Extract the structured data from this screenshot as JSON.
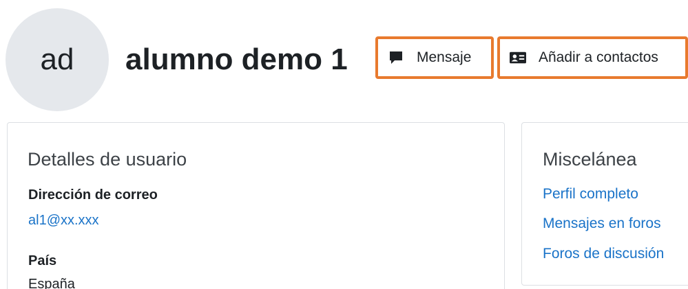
{
  "header": {
    "avatar_initials": "ad",
    "user_name": "alumno demo 1",
    "actions": {
      "message_label": "Mensaje",
      "message_icon": "speech-bubble-icon",
      "add_contact_label": "Añadir a contactos",
      "add_contact_icon": "address-card-icon"
    },
    "highlight_color": "#e87a2e"
  },
  "user_details": {
    "title": "Detalles de usuario",
    "email_label": "Dirección de correo",
    "email_value": "al1@xx.xxx",
    "country_label": "País",
    "country_value": "España"
  },
  "misc": {
    "title": "Miscelánea",
    "links": [
      "Perfil completo",
      "Mensajes en foros",
      "Foros de discusión"
    ]
  },
  "colors": {
    "link": "#1a73c8",
    "text": "#1d2125",
    "avatar_bg": "#e5e8ec"
  }
}
